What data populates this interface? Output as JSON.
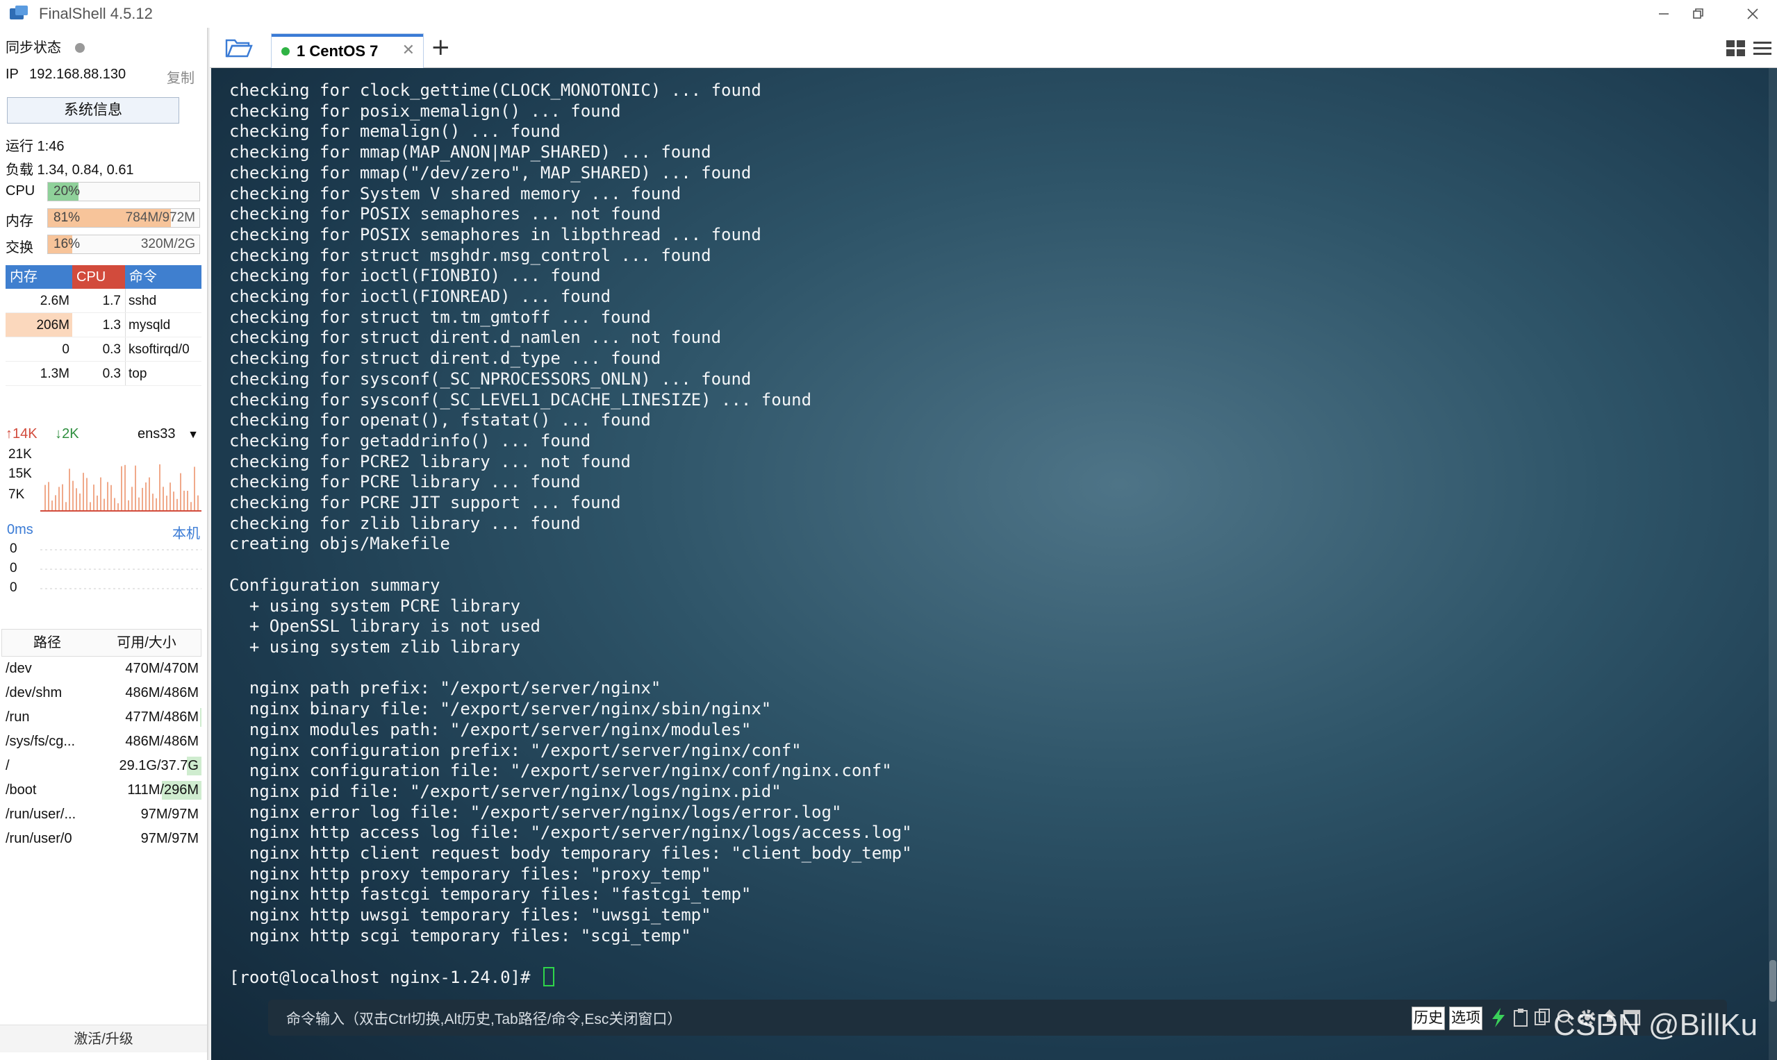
{
  "window": {
    "title": "FinalShell 4.5.12"
  },
  "sidebar": {
    "sync_label": "同步状态",
    "ip_label": "IP",
    "ip_value": "192.168.88.130",
    "copy_label": "复制",
    "sysinfo_button": "系统信息",
    "uptime": "运行 1:46",
    "load": "负载 1.34, 0.84, 0.61",
    "cpu": {
      "label": "CPU",
      "percent": "20%",
      "fraction": 0.2,
      "color": "#8fd19a"
    },
    "memory": {
      "label": "内存",
      "percent": "81%",
      "fraction": 0.81,
      "size": "784M/972M",
      "color": "#f7c49a"
    },
    "swap": {
      "label": "交换",
      "percent": "16%",
      "fraction": 0.16,
      "size": "320M/2G",
      "color": "#f7c49a"
    },
    "process_table": {
      "headers": [
        "内存",
        "CPU",
        "命令"
      ],
      "rows": [
        {
          "mem": "2.6M",
          "cpu": "1.7",
          "cmd": "sshd"
        },
        {
          "mem": "206M",
          "cpu": "1.3",
          "cmd": "mysqld"
        },
        {
          "mem": "0",
          "cpu": "0.3",
          "cmd": "ksoftirqd/0"
        },
        {
          "mem": "1.3M",
          "cpu": "0.3",
          "cmd": "top"
        }
      ]
    },
    "network": {
      "up": "14K",
      "down": "2K",
      "interface": "ens33",
      "scale": [
        "21K",
        "15K",
        "7K"
      ]
    },
    "ping": {
      "latency": "0ms",
      "target": "本机",
      "values": [
        "0",
        "0",
        "0"
      ]
    },
    "disk_table": {
      "headers": [
        "路径",
        "可用/大小"
      ],
      "rows": [
        {
          "path": "/dev",
          "size": "470M/470M",
          "used_fraction": 0.0
        },
        {
          "path": "/dev/shm",
          "size": "486M/486M",
          "used_fraction": 0.0
        },
        {
          "path": "/run",
          "size": "477M/486M",
          "used_fraction": 0.02
        },
        {
          "path": "/sys/fs/cg...",
          "size": "486M/486M",
          "used_fraction": 0.0
        },
        {
          "path": "/",
          "size": "29.1G/37.7G",
          "used_fraction": 0.23
        },
        {
          "path": "/boot",
          "size": "111M/296M",
          "used_fraction": 0.63
        },
        {
          "path": "/run/user/...",
          "size": "97M/97M",
          "used_fraction": 0.0
        },
        {
          "path": "/run/user/0",
          "size": "97M/97M",
          "used_fraction": 0.0
        }
      ]
    },
    "activate_label": "激活/升级"
  },
  "tabs": [
    {
      "label": "1 CentOS 7",
      "active": true
    }
  ],
  "terminal": {
    "lines": [
      "checking for clock_gettime(CLOCK_MONOTONIC) ... found",
      "checking for posix_memalign() ... found",
      "checking for memalign() ... found",
      "checking for mmap(MAP_ANON|MAP_SHARED) ... found",
      "checking for mmap(\"/dev/zero\", MAP_SHARED) ... found",
      "checking for System V shared memory ... found",
      "checking for POSIX semaphores ... not found",
      "checking for POSIX semaphores in libpthread ... found",
      "checking for struct msghdr.msg_control ... found",
      "checking for ioctl(FIONBIO) ... found",
      "checking for ioctl(FIONREAD) ... found",
      "checking for struct tm.tm_gmtoff ... found",
      "checking for struct dirent.d_namlen ... not found",
      "checking for struct dirent.d_type ... found",
      "checking for sysconf(_SC_NPROCESSORS_ONLN) ... found",
      "checking for sysconf(_SC_LEVEL1_DCACHE_LINESIZE) ... found",
      "checking for openat(), fstatat() ... found",
      "checking for getaddrinfo() ... found",
      "checking for PCRE2 library ... not found",
      "checking for PCRE library ... found",
      "checking for PCRE JIT support ... found",
      "checking for zlib library ... found",
      "creating objs/Makefile",
      "",
      "Configuration summary",
      "  + using system PCRE library",
      "  + OpenSSL library is not used",
      "  + using system zlib library",
      "",
      "  nginx path prefix: \"/export/server/nginx\"",
      "  nginx binary file: \"/export/server/nginx/sbin/nginx\"",
      "  nginx modules path: \"/export/server/nginx/modules\"",
      "  nginx configuration prefix: \"/export/server/nginx/conf\"",
      "  nginx configuration file: \"/export/server/nginx/conf/nginx.conf\"",
      "  nginx pid file: \"/export/server/nginx/logs/nginx.pid\"",
      "  nginx error log file: \"/export/server/nginx/logs/error.log\"",
      "  nginx http access log file: \"/export/server/nginx/logs/access.log\"",
      "  nginx http client request body temporary files: \"client_body_temp\"",
      "  nginx http proxy temporary files: \"proxy_temp\"",
      "  nginx http fastcgi temporary files: \"fastcgi_temp\"",
      "  nginx http uwsgi temporary files: \"uwsgi_temp\"",
      "  nginx http scgi temporary files: \"scgi_temp\"",
      ""
    ],
    "prompt": "[root@localhost nginx-1.24.0]# "
  },
  "command_bar": {
    "hint": "命令输入（双击Ctrl切换,Alt历史,Tab路径/命令,Esc关闭窗口）",
    "history_button": "历史",
    "options_button": "选项"
  },
  "watermark": "CSDN @BillKu",
  "colors": {
    "terminal_text": "#f4f6f8",
    "cursor": "#2fd54a",
    "accent": "#3a7bd5"
  }
}
